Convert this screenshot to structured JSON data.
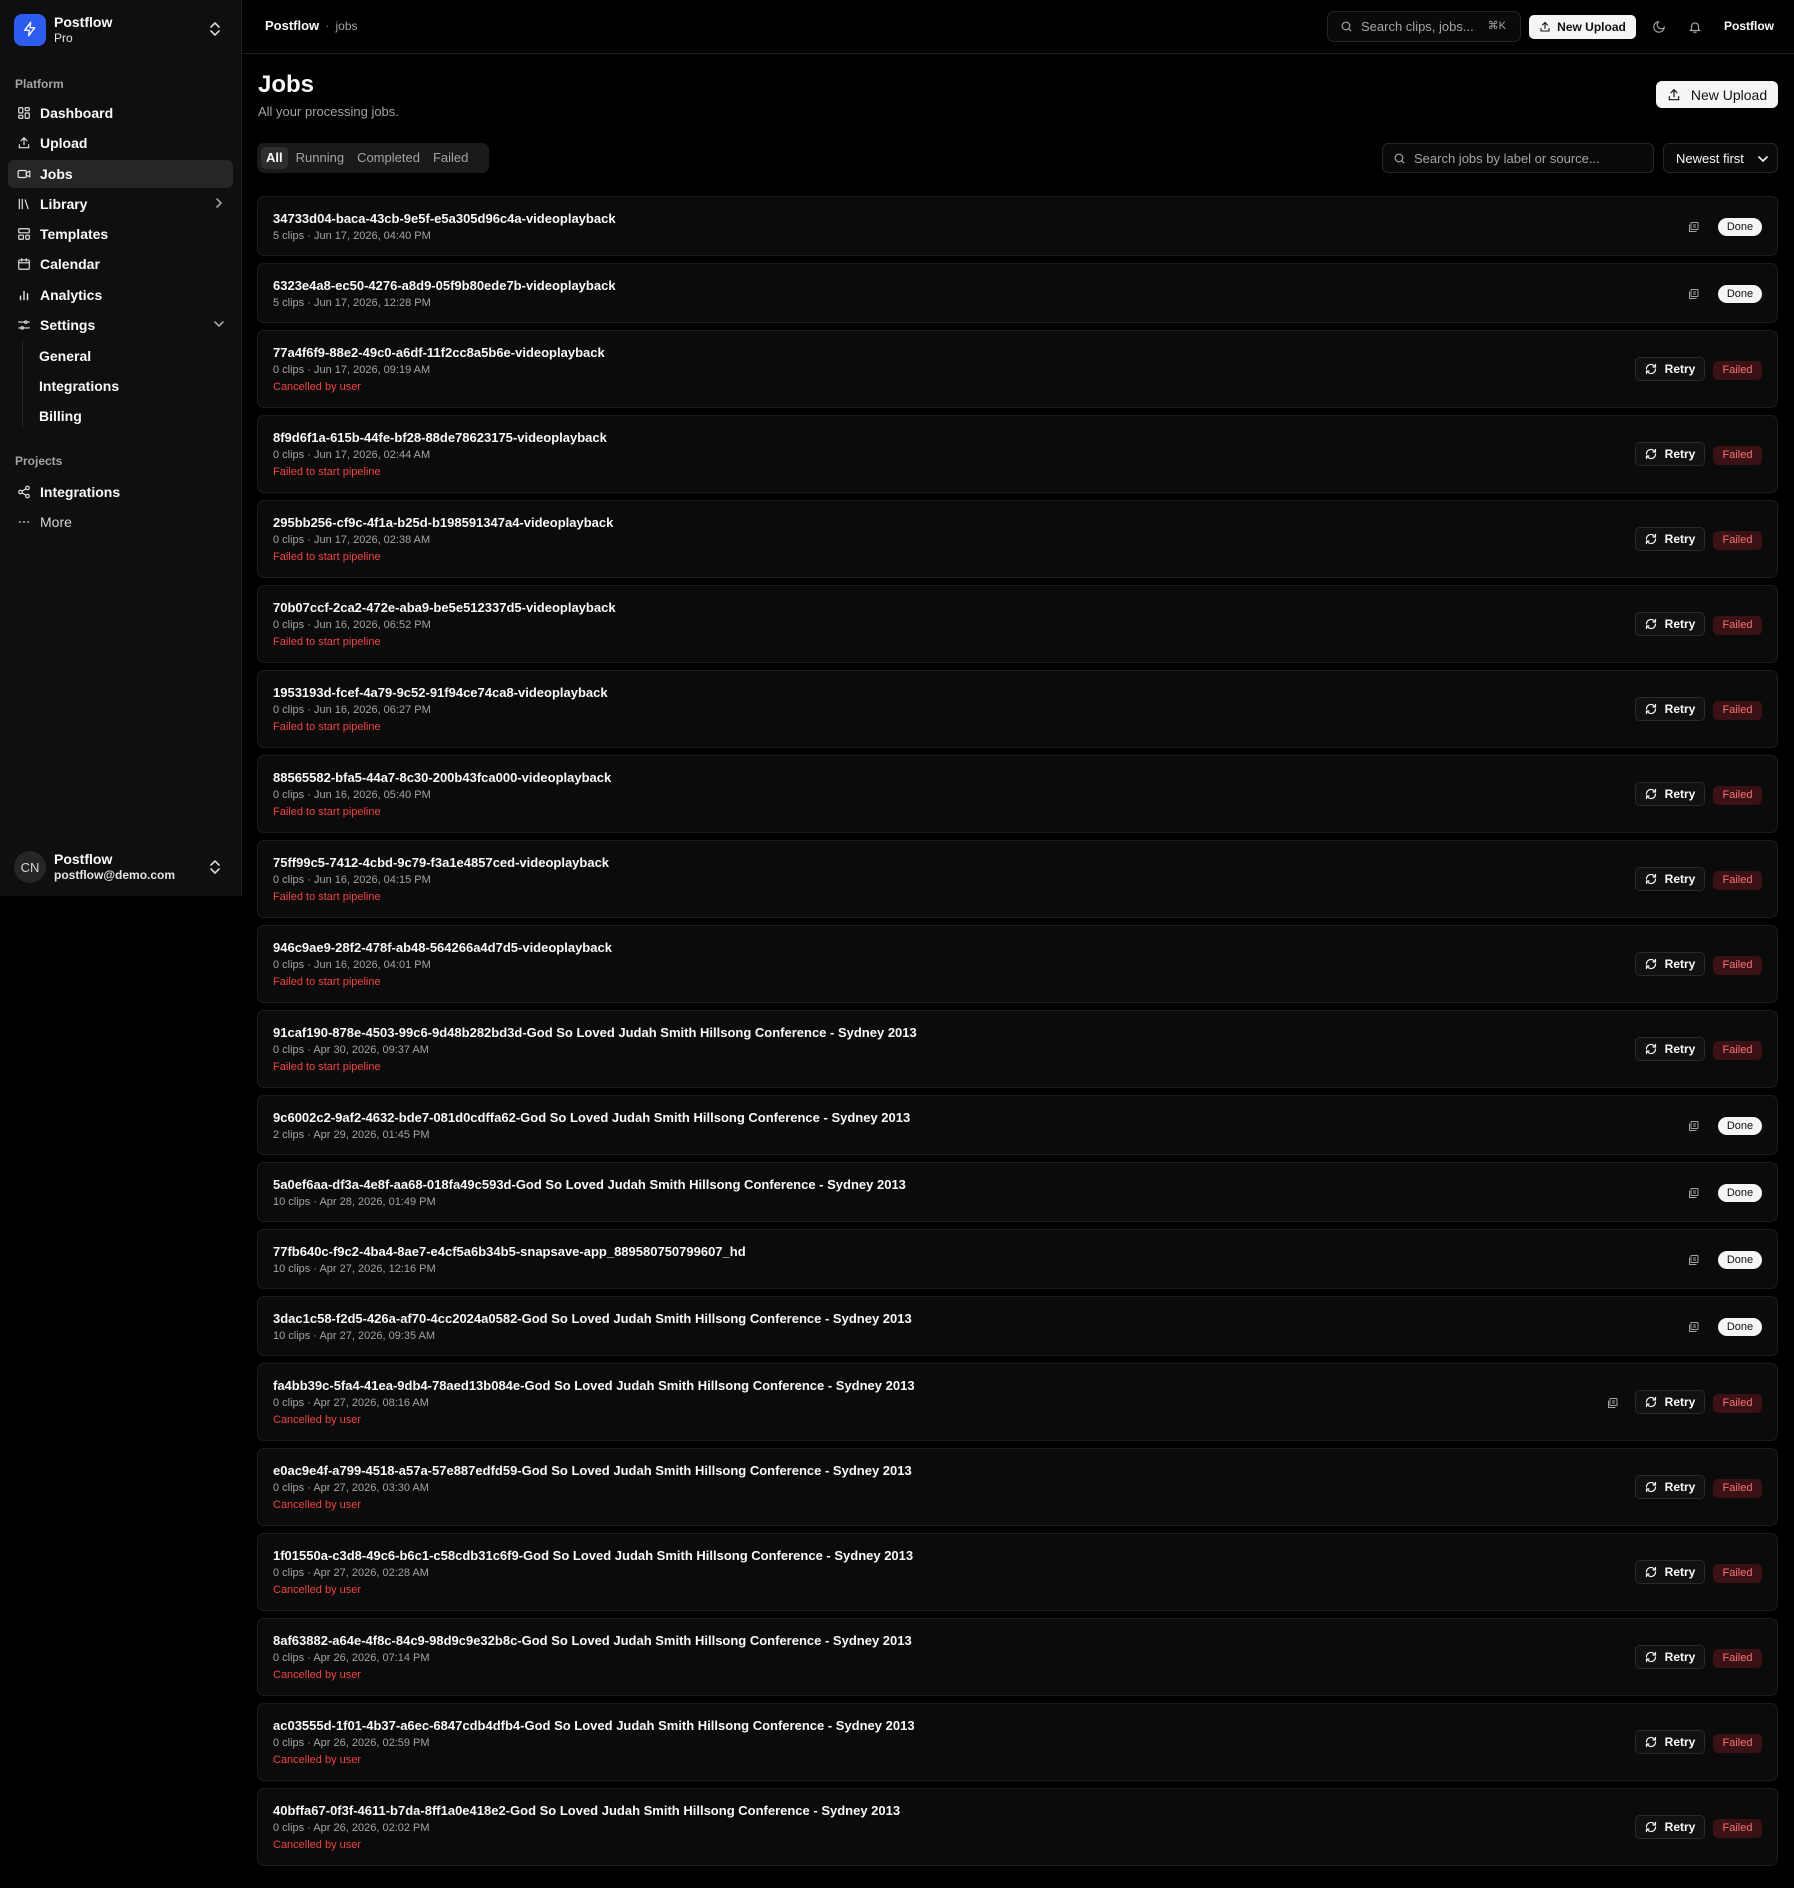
{
  "workspace": {
    "name": "Postflow",
    "plan": "Pro"
  },
  "sidebar": {
    "platform_label": "Platform",
    "items": [
      {
        "label": "Dashboard",
        "icon": "dashboard-icon"
      },
      {
        "label": "Upload",
        "icon": "upload-icon"
      },
      {
        "label": "Jobs",
        "icon": "video-icon"
      },
      {
        "label": "Library",
        "icon": "library-icon"
      },
      {
        "label": "Templates",
        "icon": "templates-icon"
      },
      {
        "label": "Calendar",
        "icon": "calendar-icon"
      },
      {
        "label": "Analytics",
        "icon": "chart-icon"
      },
      {
        "label": "Settings",
        "icon": "settings-icon"
      }
    ],
    "settings_sub": [
      "General",
      "Integrations",
      "Billing"
    ],
    "projects_label": "Projects",
    "projects": [
      {
        "label": "Integrations",
        "icon": "share-icon"
      },
      {
        "label": "More",
        "icon": "more-icon"
      }
    ]
  },
  "user": {
    "initials": "CN",
    "name": "Postflow",
    "email": "postflow@demo.com"
  },
  "topbar": {
    "breadcrumb_root": "Postflow",
    "breadcrumb_sep": "·",
    "breadcrumb_current": "jobs",
    "search_placeholder": "Search clips, jobs...",
    "search_shortcut": "⌘K",
    "upload_label": "New Upload",
    "user_label": "Postflow"
  },
  "main": {
    "title": "Jobs",
    "subtitle": "All your processing jobs.",
    "upload_label": "New Upload",
    "tabs": [
      "All",
      "Running",
      "Completed",
      "Failed"
    ],
    "search_placeholder": "Search jobs by label or source...",
    "sort_value": "Newest first"
  },
  "labels": {
    "retry": "Retry",
    "done": "Done",
    "failed": "Failed"
  },
  "colors": {
    "accent": "#2f5cf0",
    "error": "#ef4444",
    "failed_bg": "#3a1215"
  },
  "jobs": [
    {
      "title": "34733d04-baca-43cb-9e5f-e5a305d96c4a-videoplayback",
      "meta": "5 clips · Jun 17, 2026, 04:40 PM",
      "status": "done"
    },
    {
      "title": "6323e4a8-ec50-4276-a8d9-05f9b80ede7b-videoplayback",
      "meta": "5 clips · Jun 17, 2026, 12:28 PM",
      "status": "done"
    },
    {
      "title": "77a4f6f9-88e2-49c0-a6df-11f2cc8a5b6e-videoplayback",
      "meta": "0 clips · Jun 17, 2026, 09:19 AM",
      "status": "failed",
      "error": "Cancelled by user"
    },
    {
      "title": "8f9d6f1a-615b-44fe-bf28-88de78623175-videoplayback",
      "meta": "0 clips · Jun 17, 2026, 02:44 AM",
      "status": "failed",
      "error": "Failed to start pipeline"
    },
    {
      "title": "295bb256-cf9c-4f1a-b25d-b198591347a4-videoplayback",
      "meta": "0 clips · Jun 17, 2026, 02:38 AM",
      "status": "failed",
      "error": "Failed to start pipeline"
    },
    {
      "title": "70b07ccf-2ca2-472e-aba9-be5e512337d5-videoplayback",
      "meta": "0 clips · Jun 16, 2026, 06:52 PM",
      "status": "failed",
      "error": "Failed to start pipeline"
    },
    {
      "title": "1953193d-fcef-4a79-9c52-91f94ce74ca8-videoplayback",
      "meta": "0 clips · Jun 16, 2026, 06:27 PM",
      "status": "failed",
      "error": "Failed to start pipeline"
    },
    {
      "title": "88565582-bfa5-44a7-8c30-200b43fca000-videoplayback",
      "meta": "0 clips · Jun 16, 2026, 05:40 PM",
      "status": "failed",
      "error": "Failed to start pipeline"
    },
    {
      "title": "75ff99c5-7412-4cbd-9c79-f3a1e4857ced-videoplayback",
      "meta": "0 clips · Jun 16, 2026, 04:15 PM",
      "status": "failed",
      "error": "Failed to start pipeline"
    },
    {
      "title": "946c9ae9-28f2-478f-ab48-564266a4d7d5-videoplayback",
      "meta": "0 clips · Jun 16, 2026, 04:01 PM",
      "status": "failed",
      "error": "Failed to start pipeline"
    },
    {
      "title": "91caf190-878e-4503-99c6-9d48b282bd3d-God So Loved Judah Smith Hillsong Conference - Sydney 2013",
      "meta": "0 clips · Apr 30, 2026, 09:37 AM",
      "status": "failed",
      "error": "Failed to start pipeline"
    },
    {
      "title": "9c6002c2-9af2-4632-bde7-081d0cdffa62-God So Loved Judah Smith Hillsong Conference - Sydney 2013",
      "meta": "2 clips · Apr 29, 2026, 01:45 PM",
      "status": "done"
    },
    {
      "title": "5a0ef6aa-df3a-4e8f-aa68-018fa49c593d-God So Loved Judah Smith Hillsong Conference - Sydney 2013",
      "meta": "10 clips · Apr 28, 2026, 01:49 PM",
      "status": "done"
    },
    {
      "title": "77fb640c-f9c2-4ba4-8ae7-e4cf5a6b34b5-snapsave-app_889580750799607_hd",
      "meta": "10 clips · Apr 27, 2026, 12:16 PM",
      "status": "done"
    },
    {
      "title": "3dac1c58-f2d5-426a-af70-4cc2024a0582-God So Loved Judah Smith Hillsong Conference - Sydney 2013",
      "meta": "10 clips · Apr 27, 2026, 09:35 AM",
      "status": "done"
    },
    {
      "title": "fa4bb39c-5fa4-41ea-9db4-78aed13b084e-God So Loved Judah Smith Hillsong Conference - Sydney 2013",
      "meta": "0 clips · Apr 27, 2026, 08:16 AM",
      "status": "failed",
      "error": "Cancelled by user",
      "has_clips_icon": true
    },
    {
      "title": "e0ac9e4f-a799-4518-a57a-57e887edfd59-God So Loved Judah Smith Hillsong Conference - Sydney 2013",
      "meta": "0 clips · Apr 27, 2026, 03:30 AM",
      "status": "failed",
      "error": "Cancelled by user"
    },
    {
      "title": "1f01550a-c3d8-49c6-b6c1-c58cdb31c6f9-God So Loved Judah Smith Hillsong Conference - Sydney 2013",
      "meta": "0 clips · Apr 27, 2026, 02:28 AM",
      "status": "failed",
      "error": "Cancelled by user"
    },
    {
      "title": "8af63882-a64e-4f8c-84c9-98d9c9e32b8c-God So Loved Judah Smith Hillsong Conference - Sydney 2013",
      "meta": "0 clips · Apr 26, 2026, 07:14 PM",
      "status": "failed",
      "error": "Cancelled by user"
    },
    {
      "title": "ac03555d-1f01-4b37-a6ec-6847cdb4dfb4-God So Loved Judah Smith Hillsong Conference - Sydney 2013",
      "meta": "0 clips · Apr 26, 2026, 02:59 PM",
      "status": "failed",
      "error": "Cancelled by user"
    },
    {
      "title": "40bffa67-0f3f-4611-b7da-8ff1a0e418e2-God So Loved Judah Smith Hillsong Conference - Sydney 2013",
      "meta": "0 clips · Apr 26, 2026, 02:02 PM",
      "status": "failed",
      "error": "Cancelled by user"
    }
  ]
}
